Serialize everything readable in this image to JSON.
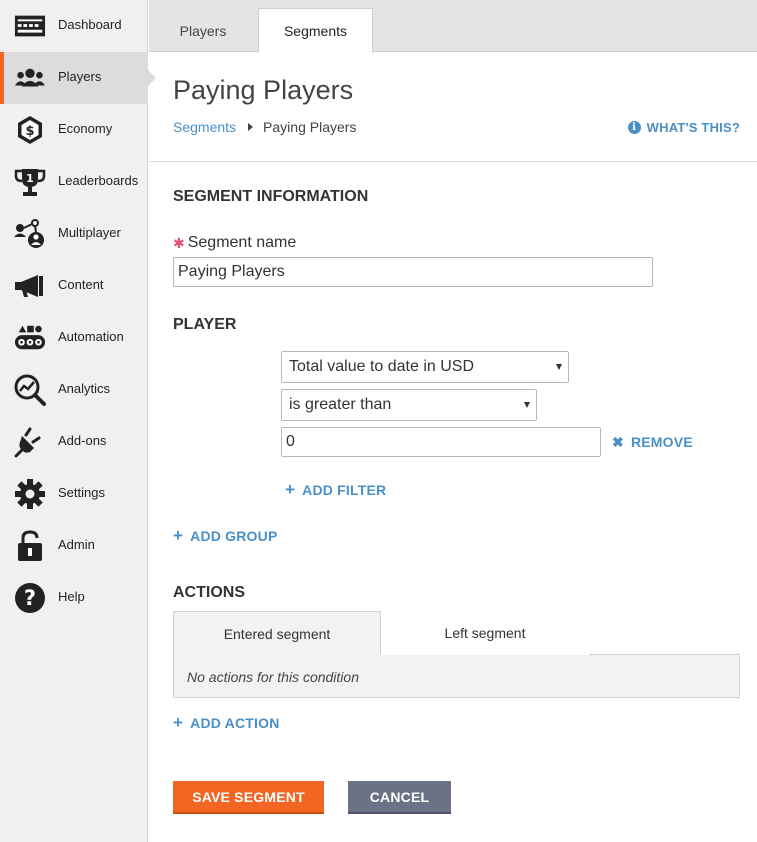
{
  "sidebar": {
    "items": [
      {
        "label": "Dashboard",
        "icon": "dashboard-icon"
      },
      {
        "label": "Players",
        "icon": "players-icon",
        "active": true
      },
      {
        "label": "Economy",
        "icon": "economy-icon"
      },
      {
        "label": "Leaderboards",
        "icon": "trophy-icon"
      },
      {
        "label": "Multiplayer",
        "icon": "multiplayer-icon"
      },
      {
        "label": "Content",
        "icon": "megaphone-icon"
      },
      {
        "label": "Automation",
        "icon": "automation-icon"
      },
      {
        "label": "Analytics",
        "icon": "analytics-icon"
      },
      {
        "label": "Add-ons",
        "icon": "plug-icon"
      },
      {
        "label": "Settings",
        "icon": "gear-icon"
      },
      {
        "label": "Admin",
        "icon": "lock-icon"
      },
      {
        "label": "Help",
        "icon": "help-icon"
      }
    ]
  },
  "tabs": {
    "players": "Players",
    "segments": "Segments"
  },
  "header": {
    "title": "Paying Players",
    "breadcrumb_root": "Segments",
    "breadcrumb_current": "Paying Players",
    "whats_this": "WHAT'S THIS?"
  },
  "segment_info": {
    "section_title": "SEGMENT INFORMATION",
    "name_label": "Segment name",
    "name_value": "Paying Players"
  },
  "player": {
    "section_title": "PLAYER",
    "filter_field": "Total value to date in USD",
    "filter_operator": "is greater than",
    "filter_value": "0",
    "remove_label": "REMOVE",
    "add_filter_label": "ADD FILTER",
    "add_group_label": "ADD GROUP"
  },
  "actions": {
    "section_title": "ACTIONS",
    "tab_entered": "Entered segment",
    "tab_left": "Left segment",
    "empty_message": "No actions for this condition",
    "add_action_label": "ADD ACTION"
  },
  "buttons": {
    "save": "SAVE SEGMENT",
    "cancel": "CANCEL"
  },
  "colors": {
    "accent": "#f26522",
    "link": "#4a90c8",
    "cancel": "#6b7285"
  }
}
